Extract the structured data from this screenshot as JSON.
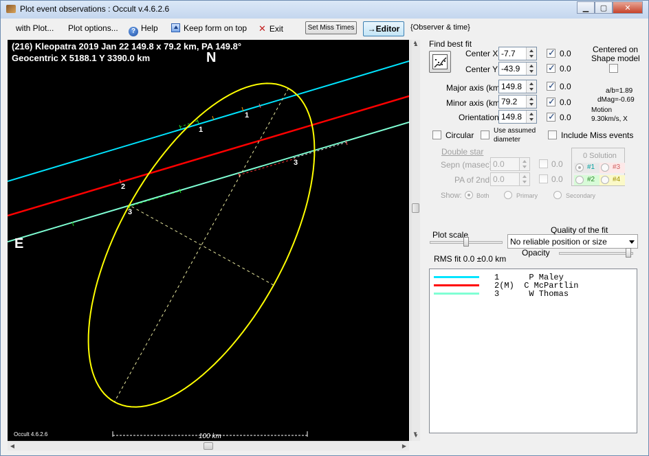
{
  "window": {
    "title": "Plot event observations : Occult v.4.6.2.6"
  },
  "menu": {
    "with_plot": "with Plot...",
    "plot_options": "Plot options...",
    "help": "Help",
    "keep_on_top": "Keep form on top",
    "exit": "Exit",
    "set_miss_times": "Set Miss Times",
    "editor": "→Editor",
    "observer_time": "{Observer & time}"
  },
  "plot": {
    "header_line1": "(216) Kleopatra  2019 Jan 22   149.8 x 79.2 km, PA 149.8°",
    "header_line2": "Geocentric  X  5188.1  Y  3390.0 km",
    "north": "N",
    "east": "E",
    "version": "Occult 4.6.2.6",
    "scale_label": "100 km",
    "chord_labels": [
      {
        "id": "1",
        "where": "chord-1-west"
      },
      {
        "id": "1",
        "where": "chord-1-east"
      },
      {
        "id": "2",
        "where": "chord-2"
      },
      {
        "id": "3",
        "where": "chord-3-west"
      },
      {
        "id": "3",
        "where": "chord-3-east"
      }
    ],
    "colors": {
      "background": "#000000",
      "ellipse": "#ffff00",
      "chord1": "#00e5ff",
      "chord2": "#ff0000",
      "chord3": "#7fffd4"
    }
  },
  "fit": {
    "find_best_fit": "Find best fit",
    "center_x": {
      "label": "Center X",
      "value": "-7.7",
      "checked": true,
      "unc": "0.0"
    },
    "center_y": {
      "label": "Center Y",
      "value": "-43.9",
      "checked": true,
      "unc": "0.0"
    },
    "major_axis": {
      "label": "Major axis (km)",
      "value": "149.8",
      "checked": true,
      "unc": "0.0"
    },
    "minor_axis": {
      "label": "Minor axis (km)",
      "value": "79.2",
      "checked": true,
      "unc": "0.0"
    },
    "orientation": {
      "label": "Orientation",
      "value": "149.8",
      "checked": true,
      "unc": "0.0"
    },
    "centered_on": "Centered on",
    "shape_model": "Shape model",
    "ab_ratio": "a/b=1.89",
    "dmag": "dMag=-0.69",
    "motion": "Motion",
    "motion_value": "9.30km/s, X",
    "circular": "Circular",
    "use_assumed_1": "Use assumed",
    "use_assumed_2": "diameter",
    "include_miss": "Include Miss events"
  },
  "double_star": {
    "title": "Double star",
    "sepn": {
      "label": "Sepn (masec)",
      "value": "0.0",
      "unc": "0.0"
    },
    "pa": {
      "label": "PA of 2nd",
      "value": "0.0",
      "unc": "0.0"
    },
    "show": "Show:",
    "both": "Both",
    "primary": "Primary",
    "secondary": "Secondary",
    "solution_title": "0 Solution",
    "sol1": "#1",
    "sol2": "#2",
    "sol3": "#3",
    "sol4": "#4"
  },
  "plot_scale": "Plot scale",
  "quality": {
    "label": "Quality of the fit",
    "value": "No reliable position or size"
  },
  "opacity": "Opacity",
  "rms_fit": "RMS fit  0.0 ±0.0 km",
  "observers": [
    {
      "text": "1      P Maley",
      "color": "#00e5ff"
    },
    {
      "text": "2(M)  C McPartlin",
      "color": "#ff0000"
    },
    {
      "text": "3      W Thomas",
      "color": "#7fffd4"
    }
  ]
}
